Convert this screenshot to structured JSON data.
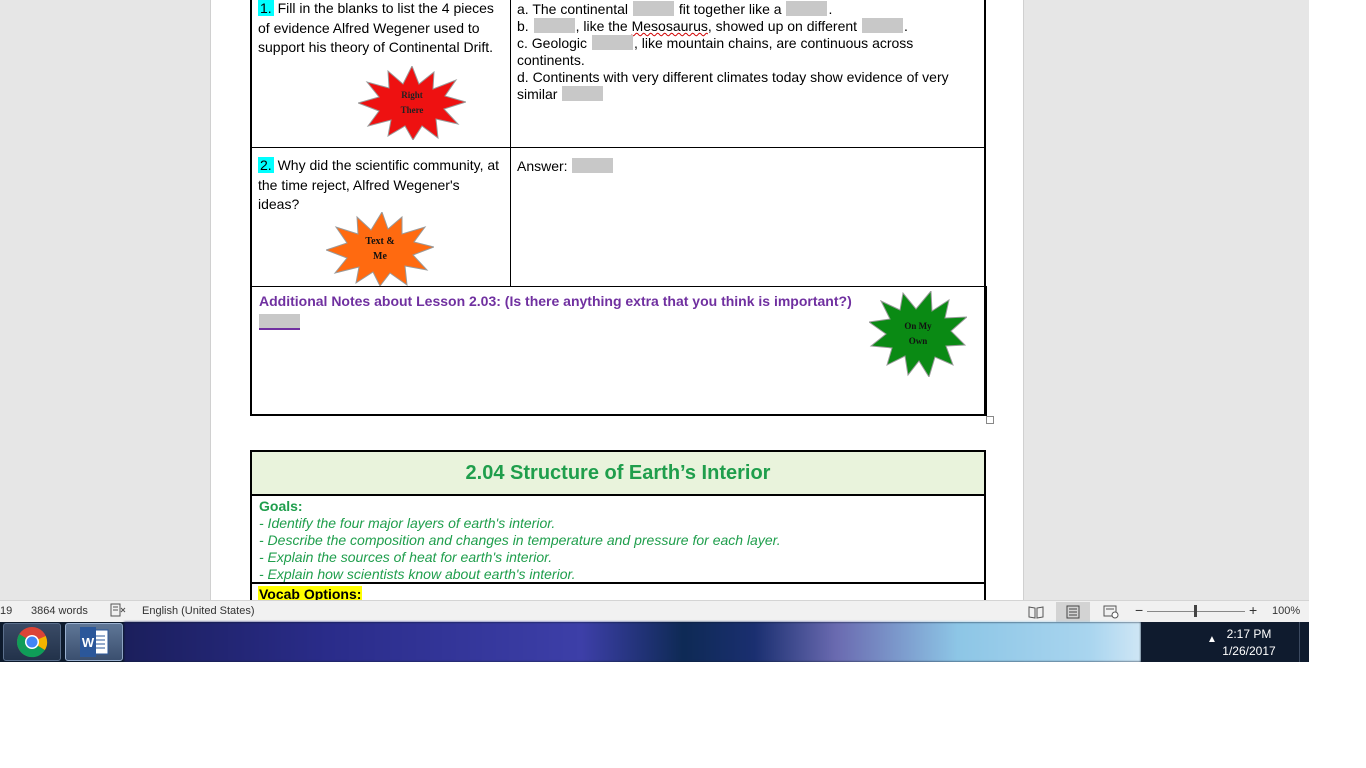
{
  "document": {
    "q1": {
      "number": "1.",
      "text": "Fill in the blanks to list the 4 pieces of evidence Alfred Wegener used to support his theory of Continental Drift.",
      "badge": "Right\nThere",
      "answer": {
        "a_pre": "a. The continental",
        "a_mid": "fit together like a",
        "a_post": ".",
        "b_pre": "b.",
        "b_mid1": ", like the",
        "b_word": "Mesosaurus",
        "b_mid2": ", showed up on different",
        "b_post": ".",
        "c_pre": "c. Geologic",
        "c_post": ", like mountain chains, are continuous across continents.",
        "d_pre": "d. Continents with very different climates today show evidence of very similar"
      }
    },
    "q2": {
      "number": "2.",
      "text": "Why did the scientific community, at the time reject, Alfred Wegener's ideas?",
      "badge": "Text &\nMe",
      "answer_label": "Answer:"
    },
    "notes": {
      "title": "Additional Notes about Lesson 2.03: (Is there anything extra that you think is important?)",
      "badge": "On My\nOwn"
    },
    "section": {
      "title": "2.04 Structure of Earth’s Interior",
      "goals_title": "Goals:",
      "goals": [
        "- Identify the four major layers of earth's interior.",
        "- Describe the composition and changes in temperature and pressure for each layer.",
        "- Explain the sources of heat for earth's interior.",
        "- Explain how scientists know about earth's interior."
      ],
      "vocab_label": "Vocab Options:"
    }
  },
  "statusbar": {
    "page": "19",
    "words": "3864 words",
    "language": "English (United States)",
    "zoom": "100%",
    "zoom_level_percent": 100
  },
  "taskbar": {
    "time": "2:17 PM",
    "date": "1/26/2017",
    "apps": [
      "chrome-icon",
      "word-icon"
    ]
  },
  "colors": {
    "badge_red": "#ee1111",
    "badge_orange": "#ff6a10",
    "badge_green": "#0a8a14",
    "highlight_cyan": "#00ffff",
    "notes_purple": "#7030a0",
    "section_green": "#1f9e4c",
    "vocab_yellow": "#ffff00"
  }
}
